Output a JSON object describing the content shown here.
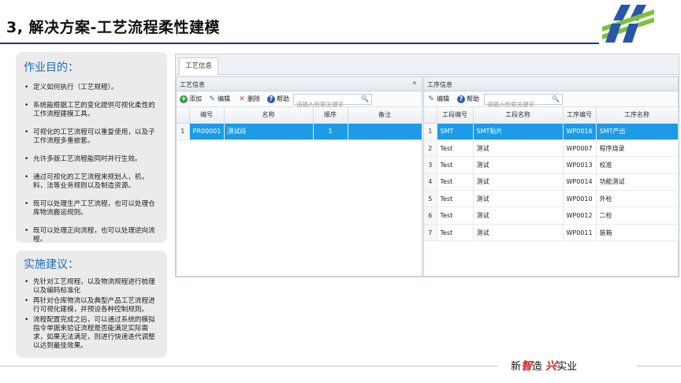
{
  "slide": {
    "title": "3, 解决方案-工艺流程柔性建模",
    "footer_slogan": {
      "part1": "新",
      "part2": "智",
      "part3": "造 ",
      "part4": "兴",
      "part5": "实业"
    }
  },
  "purpose": {
    "title": "作业目的：",
    "items": [
      "定义如何执行（工艺规程）。",
      "系统能根据工艺的变化提供可视化柔性的工作流程建模工具。",
      "可视化的工艺流程可以重复使用，以及子工作流程多重嵌套。",
      "允许多版工艺流程能同时并行生效。",
      "通过可视化的工艺流程来规划人，机，料，法等业务规则以及制造资源。",
      "既可以处理生产工艺流程，也可以处理仓库物流搬运规则。",
      "既可以处理正向流程，也可以处理逆向流程。"
    ]
  },
  "advice": {
    "title": "实施建议：",
    "items": [
      "先针对工艺规程，以及物流规程进行梳理以及编码标准化",
      "再针对仓库物流以及典型产品工艺流程进行可视化建模，并预设各种控制规则。",
      "流程配置完成之后，可以通过系统的模拟指令单据来验证流程是否能满足实际需求，如果无法满足，则进行快速迭代调整以达到最佳效果。"
    ]
  },
  "app": {
    "tab_label": "工艺信息",
    "left": {
      "title": "工艺信息",
      "collapse_glyph": "«",
      "toolbar": {
        "add": "添加",
        "edit": "编辑",
        "delete": "删除",
        "help": "帮助",
        "search_placeholder": "请输入检索关键字"
      },
      "columns": [
        "编号",
        "名称",
        "顺序",
        "备注"
      ],
      "rows": [
        {
          "num": "1",
          "code": "PR00001",
          "name": "测试段",
          "order": "1",
          "remark": ""
        }
      ]
    },
    "right": {
      "title": "工序信息",
      "toolbar": {
        "edit": "编辑",
        "help": "帮助",
        "search_placeholder": "请输入检索关键字"
      },
      "columns": [
        "工段编号",
        "工段名称",
        "工序编号",
        "工序名称"
      ],
      "rows": [
        {
          "num": "1",
          "seg_code": "SMT",
          "seg_name": "SMT贴片",
          "op_code": "WP0016",
          "op_name": "SMT产出"
        },
        {
          "num": "2",
          "seg_code": "Test",
          "seg_name": "测试",
          "op_code": "WP0007",
          "op_name": "程序烧录"
        },
        {
          "num": "3",
          "seg_code": "Test",
          "seg_name": "测试",
          "op_code": "WP0013",
          "op_name": "校准"
        },
        {
          "num": "4",
          "seg_code": "Test",
          "seg_name": "测试",
          "op_code": "WP0014",
          "op_name": "功能测试"
        },
        {
          "num": "5",
          "seg_code": "Test",
          "seg_name": "测试",
          "op_code": "WP0010",
          "op_name": "外检"
        },
        {
          "num": "6",
          "seg_code": "Test",
          "seg_name": "测试",
          "op_code": "WP0012",
          "op_name": "二检"
        },
        {
          "num": "7",
          "seg_code": "Test",
          "seg_name": "测试",
          "op_code": "WP0011",
          "op_name": "装箱"
        }
      ]
    }
  },
  "colors": {
    "selected_row": "#1d9be6",
    "panel_title": "#1f6fb8",
    "header_line": "#2a3a6a",
    "slogan_accent": "#d42020"
  }
}
